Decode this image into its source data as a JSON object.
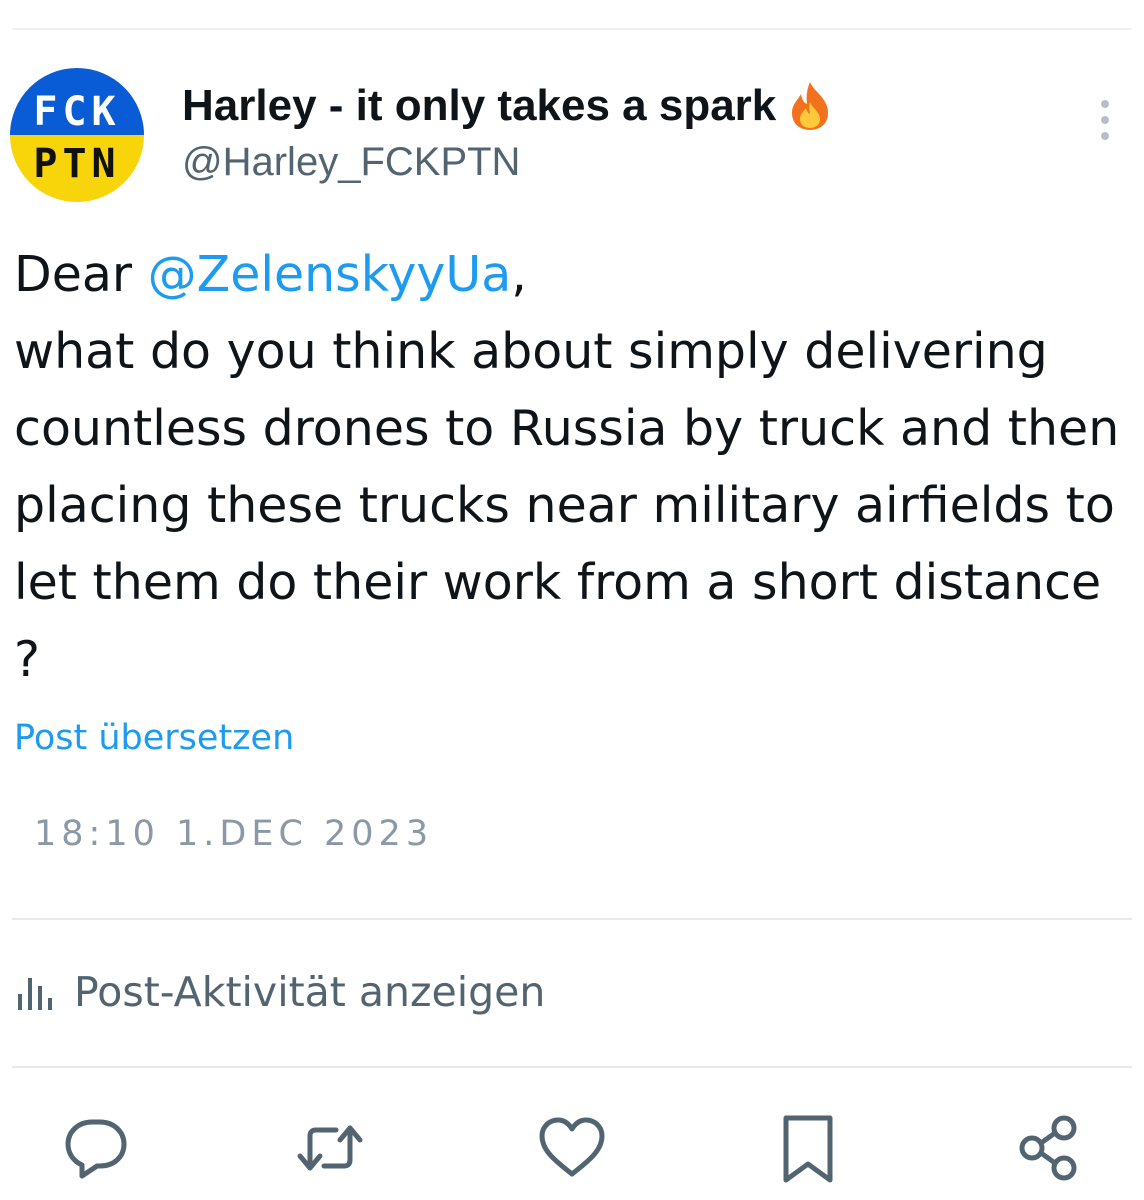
{
  "author": {
    "avatar_text_line1": "FCK",
    "avatar_text_line2": "PTN",
    "display_name": "Harley - it only takes a spark",
    "name_emoji_icon": "fire-icon",
    "handle": "@Harley_FCKPTN"
  },
  "post": {
    "text_before_mention": "Dear ",
    "mention": "@ZelenskyyUa",
    "text_after_mention": ",\nwhat do you think about simply delivering countless drones to Russia by truck and then placing these trucks near military airfields to let them do their work from a short distance ?",
    "translate_label": "Post übersetzen",
    "timestamp": "18:10 1.DEC 2023"
  },
  "activity": {
    "icon": "bar-chart-icon",
    "label": "Post-Aktivität anzeigen"
  },
  "actions": [
    {
      "name": "reply",
      "icon": "speech-bubble-icon"
    },
    {
      "name": "repost",
      "icon": "repost-arrows-icon"
    },
    {
      "name": "like",
      "icon": "heart-icon"
    },
    {
      "name": "bookmark",
      "icon": "bookmark-icon"
    },
    {
      "name": "share",
      "icon": "share-icon"
    }
  ],
  "colors": {
    "link_blue": "#1d9bf0",
    "secondary_text": "#536471",
    "timestamp_gray": "#8b98a5",
    "icon_gray": "#536471",
    "avatar_blue": "#0a5bd6",
    "avatar_yellow": "#f8d40a"
  }
}
